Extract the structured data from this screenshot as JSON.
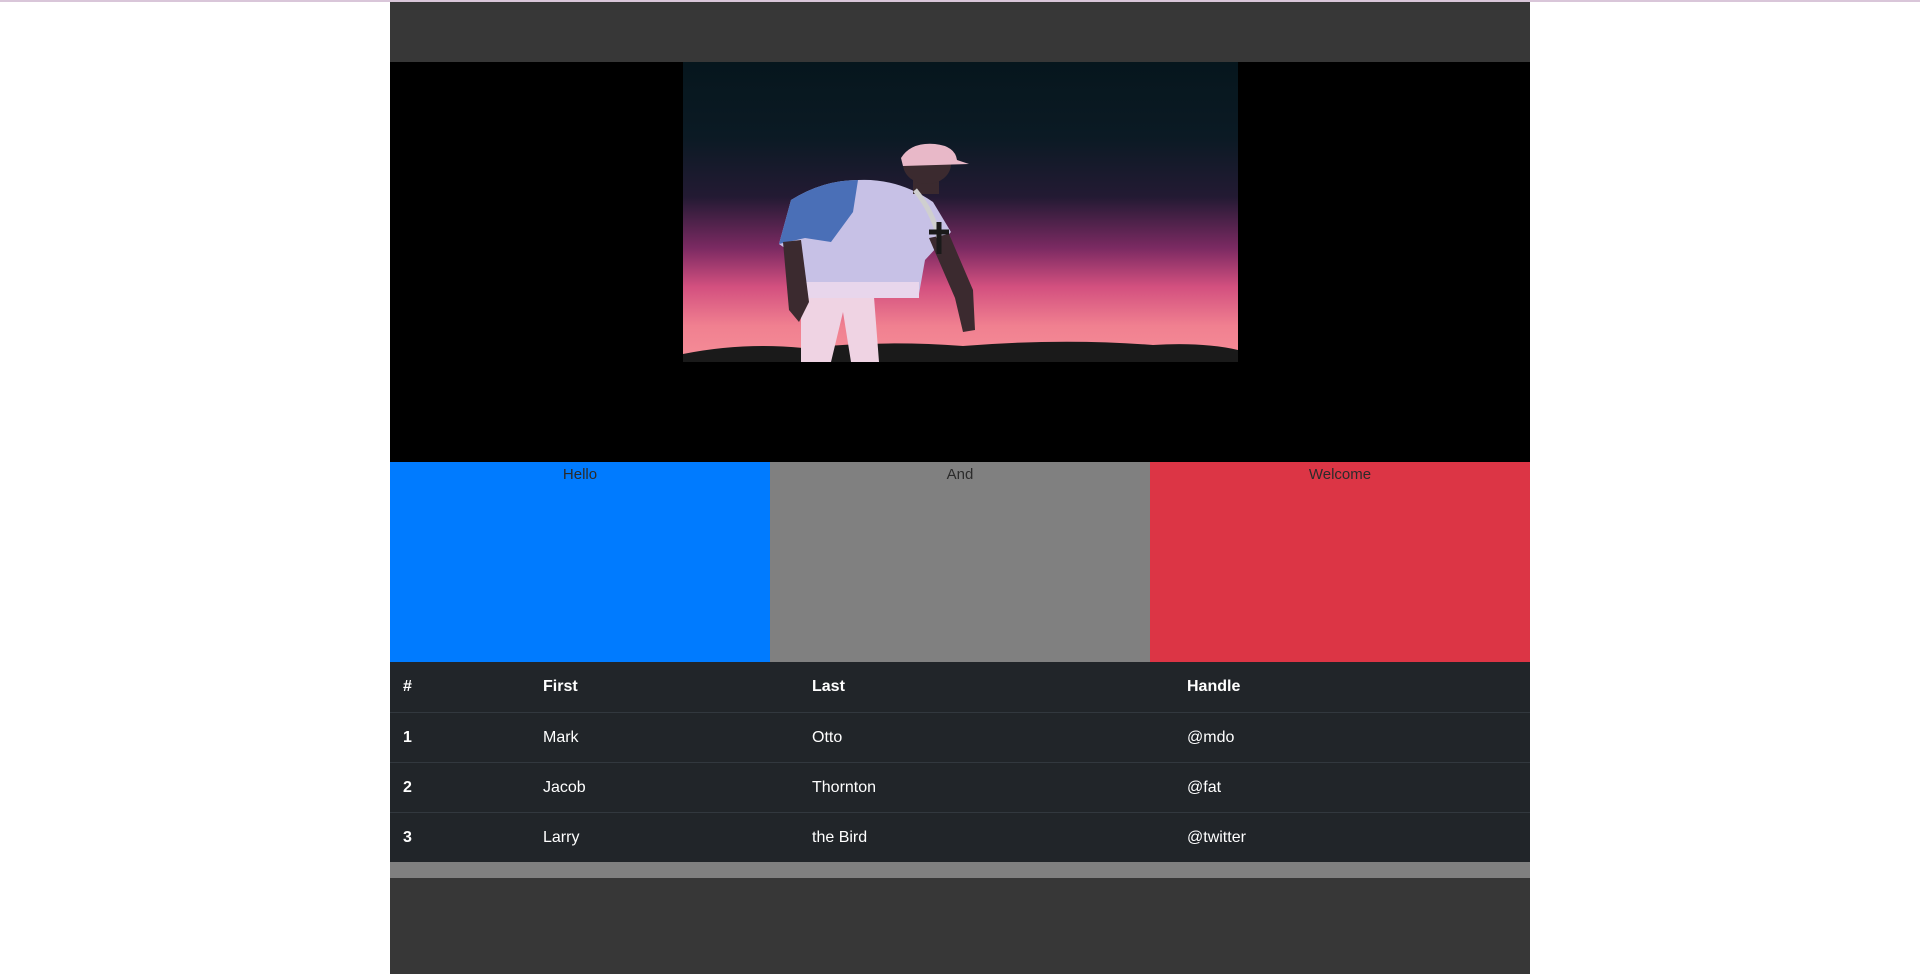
{
  "hero": {
    "image_icon": "hero-photo"
  },
  "tiles": [
    {
      "label": "Hello",
      "color": "#007bff"
    },
    {
      "label": "And",
      "color": "#808080"
    },
    {
      "label": "Welcome",
      "color": "#dc3545"
    }
  ],
  "table": {
    "headers": [
      "#",
      "First",
      "Last",
      "Handle"
    ],
    "rows": [
      [
        "1",
        "Mark",
        "Otto",
        "@mdo"
      ],
      [
        "2",
        "Jacob",
        "Thornton",
        "@fat"
      ],
      [
        "3",
        "Larry",
        "the Bird",
        "@twitter"
      ]
    ]
  }
}
